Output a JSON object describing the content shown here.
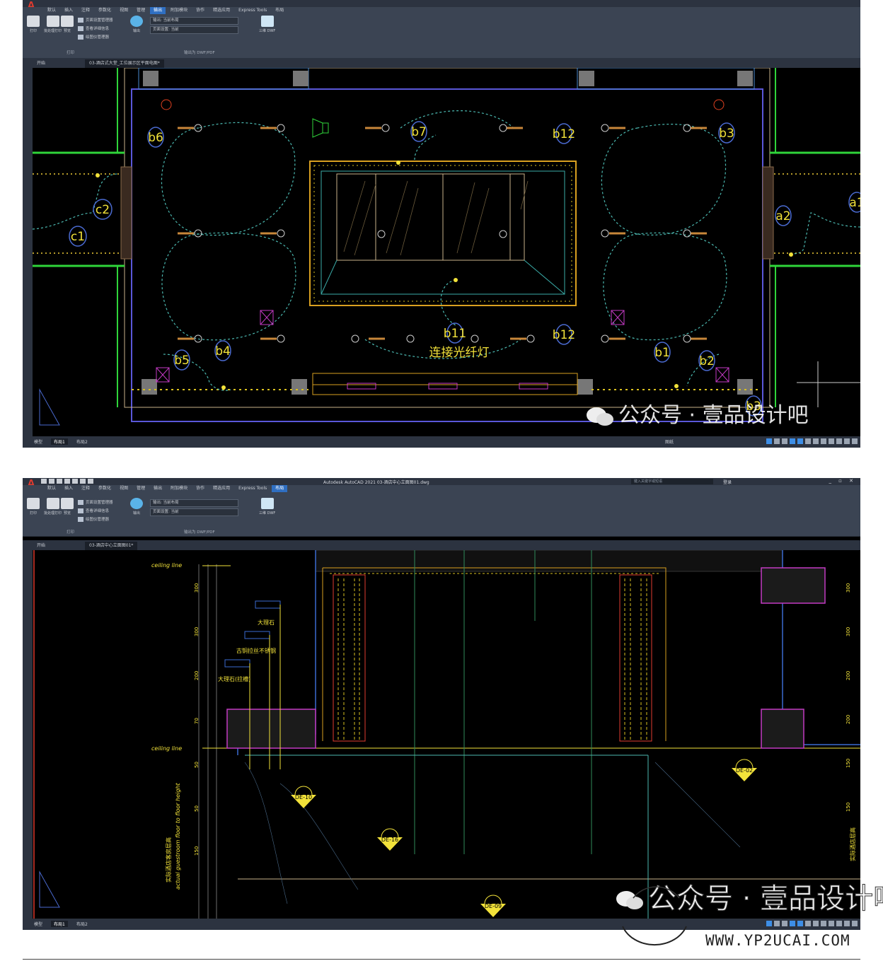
{
  "screenshot1": {
    "ribbon": {
      "tabs": [
        "默认",
        "插入",
        "注释",
        "参数化",
        "视图",
        "管理",
        "输出",
        "附加模块",
        "协作",
        "精选应用",
        "Express Tools",
        "布局"
      ],
      "active_tab": "输出",
      "buttons": {
        "print": "打印",
        "batch_plot": "批处理打印",
        "preview": "预览",
        "export": "输出",
        "dwf": "三维 DWF"
      },
      "page_setup_items": [
        "页面设置管理器",
        "查看详细信息",
        "绘图仪管理器"
      ],
      "dropdown1": "输出: 当前布局",
      "dropdown2": "页面设置: 当前",
      "group_print": "打印",
      "group_export": "输出为 DWF/PDF"
    },
    "doc_tabs": [
      "开始",
      "03-酒店式大堂_工位展示区平面电图*"
    ],
    "labels": {
      "b1": "b1",
      "b2": "b2",
      "b3": "b3",
      "b4": "b4",
      "b5": "b5",
      "b6": "b6",
      "b7": "b7",
      "b11": "b11",
      "b12a": "b12",
      "b12b": "b12",
      "c1": "c1",
      "c2": "c2",
      "a1": "a1",
      "a2": "a2",
      "b3_bottom": "b3"
    },
    "annotation": "连接光纤灯",
    "status_tabs": [
      "模型",
      "布局1",
      "布局2"
    ],
    "status_mode": "图纸"
  },
  "screenshot2": {
    "title": "Autodesk AutoCAD 2021   03-酒店中心立面图01.dwg",
    "search_placeholder": "键入关键字或短语",
    "login": "登录",
    "ribbon": {
      "tabs": [
        "默认",
        "插入",
        "注释",
        "参数化",
        "视图",
        "管理",
        "输出",
        "附加模块",
        "协作",
        "精选应用",
        "Express Tools",
        "布局"
      ],
      "active_tab": "布局",
      "buttons": {
        "print": "打印",
        "batch_plot": "批处理打印",
        "preview": "预览",
        "export": "输出",
        "dwf": "三维 DWF"
      },
      "page_setup_items": [
        "页面设置管理器",
        "查看详细信息",
        "绘图仪管理器"
      ],
      "dropdown1": "输出: 当前布局",
      "dropdown2": "页面设置: 当前",
      "group_print": "打印",
      "group_export": "输出为 DWF/PDF"
    },
    "doc_tabs": [
      "开始",
      "03-酒店中心立面图01*"
    ],
    "labels": {
      "ceiling_top": "ceiling line",
      "ceiling_mid": "ceiling line",
      "marble": "大理石",
      "steel": "古铜拉丝不锈钢",
      "marble_polished": "大理石(拉槽)",
      "de10": "DE-10",
      "de16": "DE-16",
      "de02": "DE-02",
      "de09": "DE-09",
      "vertical_note": "actual guestroom floor to floor height",
      "vertical_note_cn": "实际酒店客房层高",
      "vertical_note_right": "实际酒店层高"
    },
    "dims_left": [
      "300",
      "300",
      "200",
      "70",
      "50",
      "50",
      "150"
    ],
    "dims_right": [
      "300",
      "300",
      "200",
      "200",
      "150",
      "150"
    ],
    "status_tabs": [
      "模型",
      "布局1",
      "布局2"
    ]
  },
  "watermark": "公众号 · 壹品设计吧",
  "brand_overlay": "公众号 · 壹品设计吧",
  "url": "WWW.YP2UCAI.COM"
}
